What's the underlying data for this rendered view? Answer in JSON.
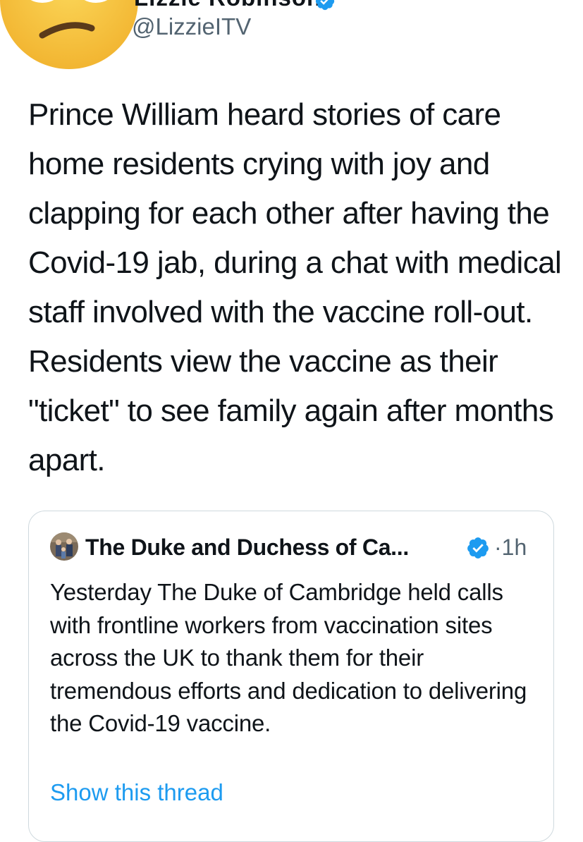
{
  "author": {
    "display_name": "Lizzie Robinson",
    "handle": "@LizzieITV",
    "avatar_icon": "unamused-face-emoji-icon",
    "verified_icon": "verified-badge-icon"
  },
  "tweet": {
    "text": "Prince William heard stories of care home residents crying with joy and clapping for each other after having the Covid-19 jab, during a chat with medical staff involved with the vaccine roll-out. Residents view the vaccine as their \"ticket\" to see family again after months apart."
  },
  "quoted_tweet": {
    "author_name": "The Duke and Duchess of Ca...",
    "separator": "·",
    "time": "1h",
    "avatar_icon": "family-photo-avatar",
    "verified_icon": "verified-badge-icon",
    "text": "Yesterday The Duke of Cambridge held calls with frontline workers from vaccination sites across the UK to thank them for their tremendous efforts and dedication to delivering the Covid-19 vaccine.",
    "show_thread_label": "Show this thread"
  },
  "colors": {
    "text_primary": "#0f1419",
    "text_secondary": "#536471",
    "link_blue": "#1d9bf0",
    "border": "#cfd9de",
    "emoji_yellow": "#f7c53c"
  }
}
